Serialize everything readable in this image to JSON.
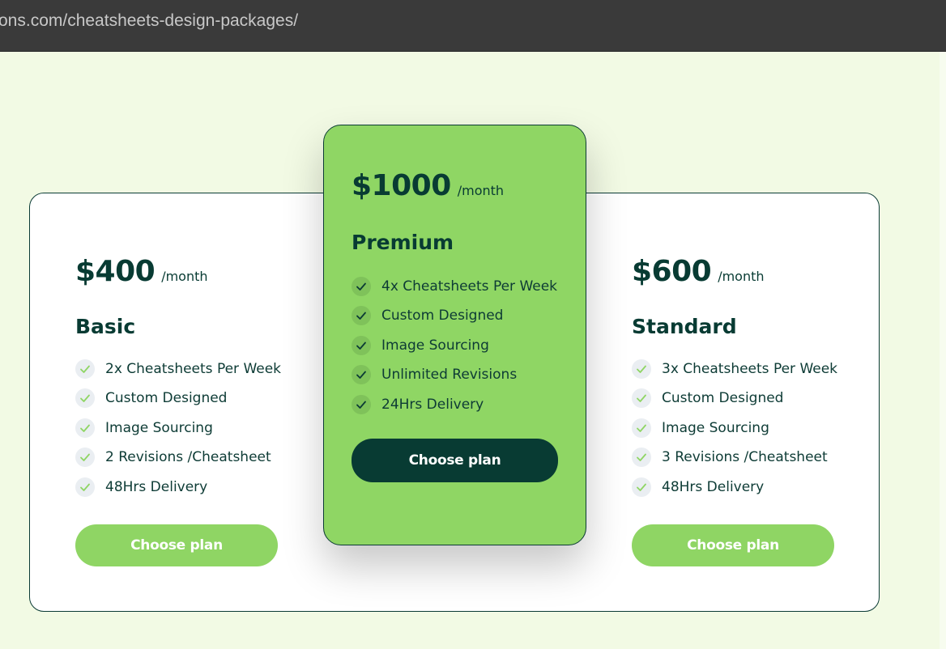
{
  "browser": {
    "url": "ons.com/cheatsheets-design-packages/"
  },
  "colors": {
    "page_bg": "#f2fae4",
    "brand_dark": "#083b33",
    "accent_green": "#8fd564"
  },
  "plans": {
    "basic": {
      "price": "$400",
      "period": "/month",
      "name": "Basic",
      "features": [
        "2x Cheatsheets Per Week",
        "Custom Designed",
        "Image Sourcing",
        "2 Revisions /Cheatsheet",
        "48Hrs Delivery"
      ],
      "cta": "Choose plan"
    },
    "premium": {
      "price": "$1000",
      "period": "/month",
      "name": "Premium",
      "features": [
        "4x Cheatsheets Per Week",
        "Custom Designed",
        "Image Sourcing",
        "Unlimited Revisions",
        "24Hrs Delivery"
      ],
      "cta": "Choose plan"
    },
    "standard": {
      "price": "$600",
      "period": "/month",
      "name": "Standard",
      "features": [
        "3x Cheatsheets Per Week",
        "Custom Designed",
        "Image Sourcing",
        "3 Revisions /Cheatsheet",
        "48Hrs Delivery"
      ],
      "cta": "Choose plan"
    }
  },
  "icons": {
    "feature_check": "check-icon"
  }
}
